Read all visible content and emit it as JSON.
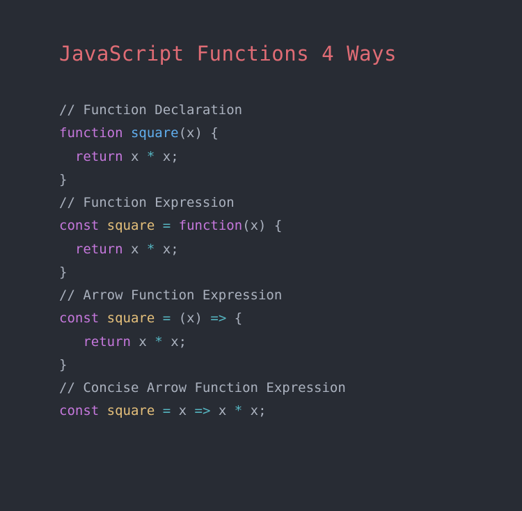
{
  "title": "JavaScript Functions 4 Ways",
  "blocks": [
    {
      "comment": "// Function Declaration",
      "line1_a": "function",
      "line1_b": " ",
      "line1_c": "square",
      "line1_d": "(x) {",
      "line2_a": "  ",
      "line2_b": "return",
      "line2_c": " x ",
      "line2_d": "*",
      "line2_e": " x;",
      "line3": "}"
    },
    {
      "comment": "// Function Expression",
      "line1_a": "const",
      "line1_b": " ",
      "line1_c": "square",
      "line1_d": " ",
      "line1_e": "=",
      "line1_f": " ",
      "line1_g": "function",
      "line1_h": "(x) {",
      "line2_a": "  ",
      "line2_b": "return",
      "line2_c": " x ",
      "line2_d": "*",
      "line2_e": " x;",
      "line3": "}"
    },
    {
      "comment": "// Arrow Function Expression",
      "line1_a": "const",
      "line1_b": " ",
      "line1_c": "square",
      "line1_d": " ",
      "line1_e": "=",
      "line1_f": " (x) ",
      "line1_g": "=>",
      "line1_h": " {",
      "line2_a": "   ",
      "line2_b": "return",
      "line2_c": " x ",
      "line2_d": "*",
      "line2_e": " x;",
      "line3": "}"
    },
    {
      "comment": "// Concise Arrow Function Expression",
      "line1_a": "const",
      "line1_b": " ",
      "line1_c": "square",
      "line1_d": " ",
      "line1_e": "=",
      "line1_f": " x ",
      "line1_g": "=>",
      "line1_h": " x ",
      "line1_i": "*",
      "line1_j": " x;"
    }
  ]
}
